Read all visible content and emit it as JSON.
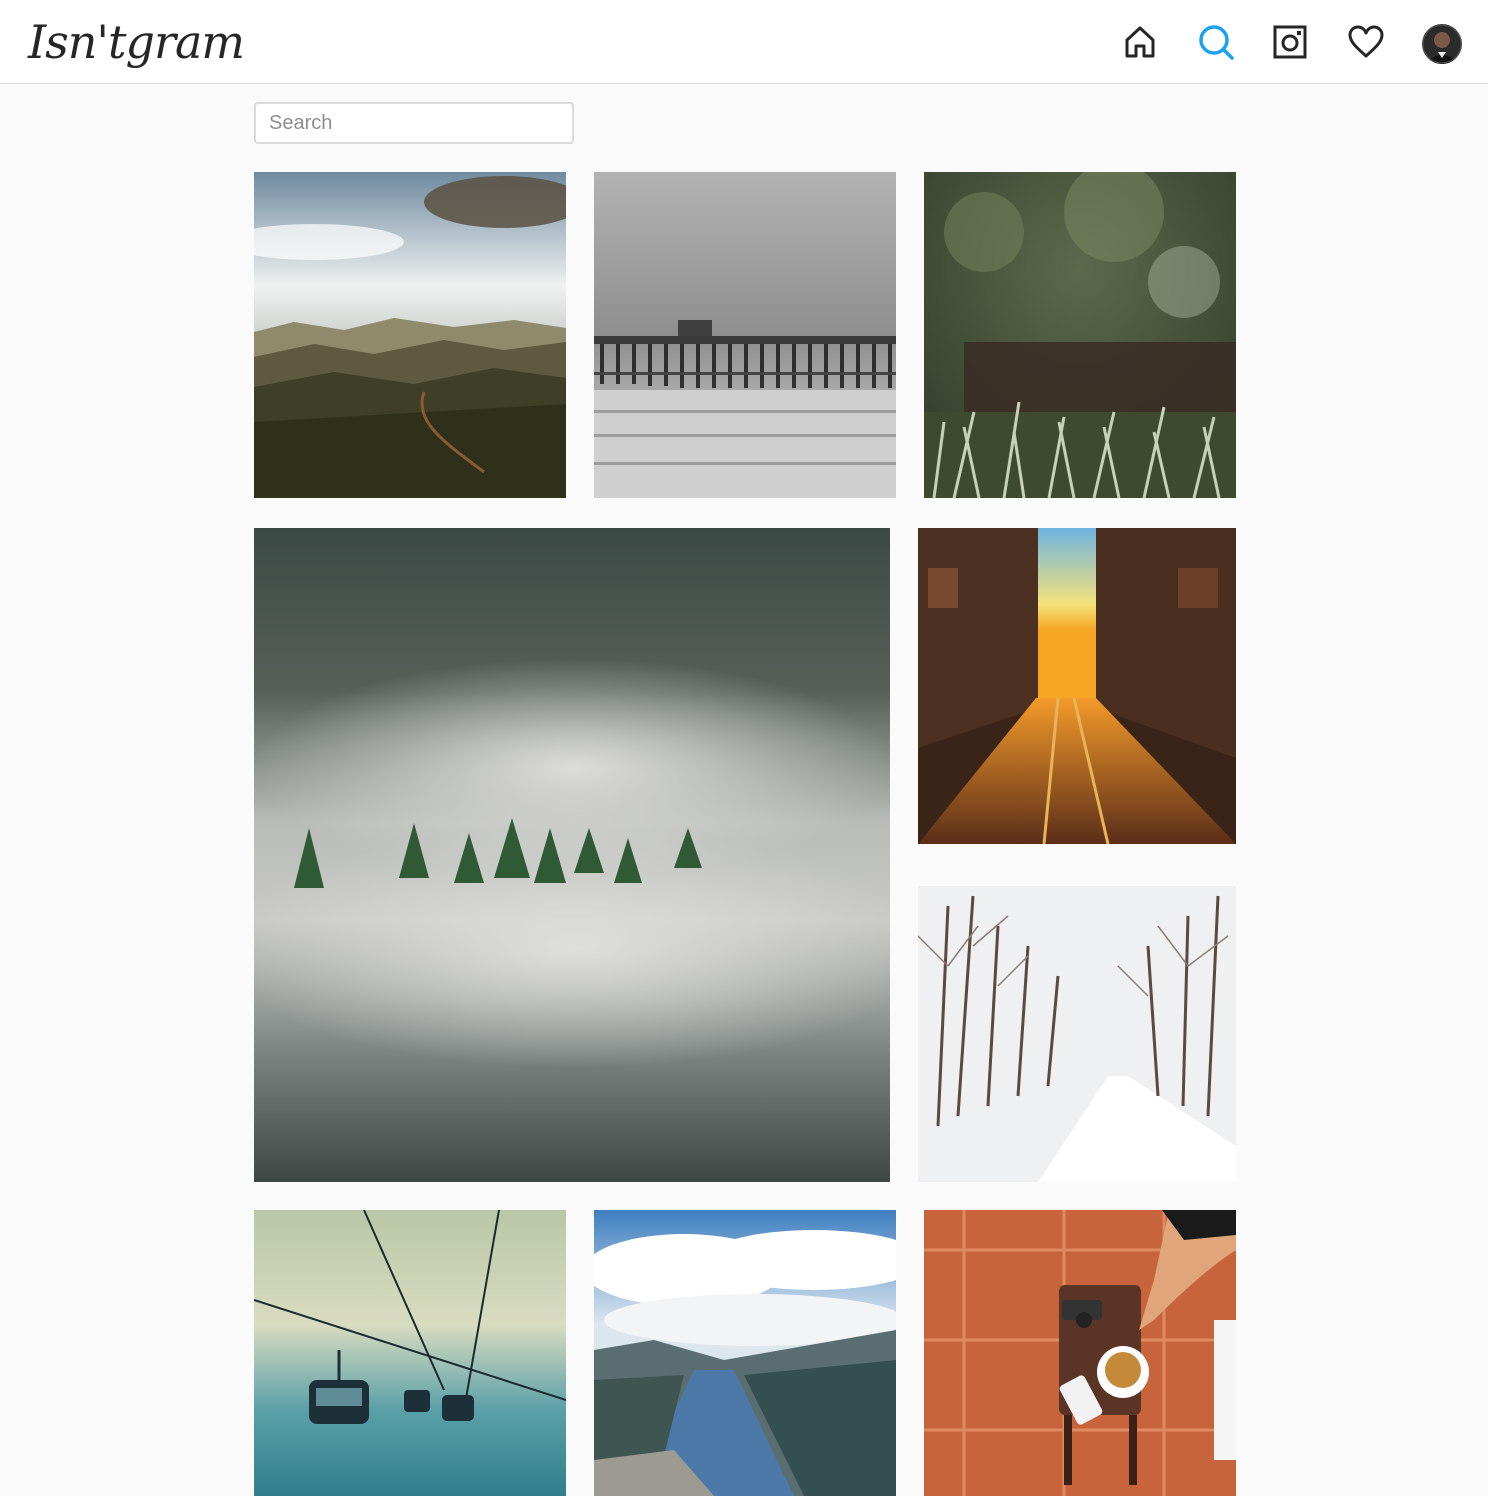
{
  "app": {
    "logo_text": "Isn'tgram"
  },
  "nav": {
    "items": [
      {
        "icon": "home-icon",
        "active": false
      },
      {
        "icon": "search-icon",
        "active": true
      },
      {
        "icon": "camera-icon",
        "active": false
      },
      {
        "icon": "heart-icon",
        "active": false
      },
      {
        "icon": "avatar",
        "active": false
      }
    ],
    "active_color": "#1da1f2",
    "icon_color": "#262626"
  },
  "search": {
    "placeholder": "Search",
    "value": ""
  },
  "photos": [
    {
      "subject": "mountain-valley-landscape"
    },
    {
      "subject": "pier-over-ocean-black-and-white"
    },
    {
      "subject": "grass-closeup-bokeh"
    },
    {
      "subject": "misty-forest-lake"
    },
    {
      "subject": "sunset-city-street"
    },
    {
      "subject": "snowy-tree-lined-road"
    },
    {
      "subject": "ski-gondola-lift"
    },
    {
      "subject": "fjord-from-cliff"
    },
    {
      "subject": "coffee-cup-camera-phone-table"
    }
  ]
}
